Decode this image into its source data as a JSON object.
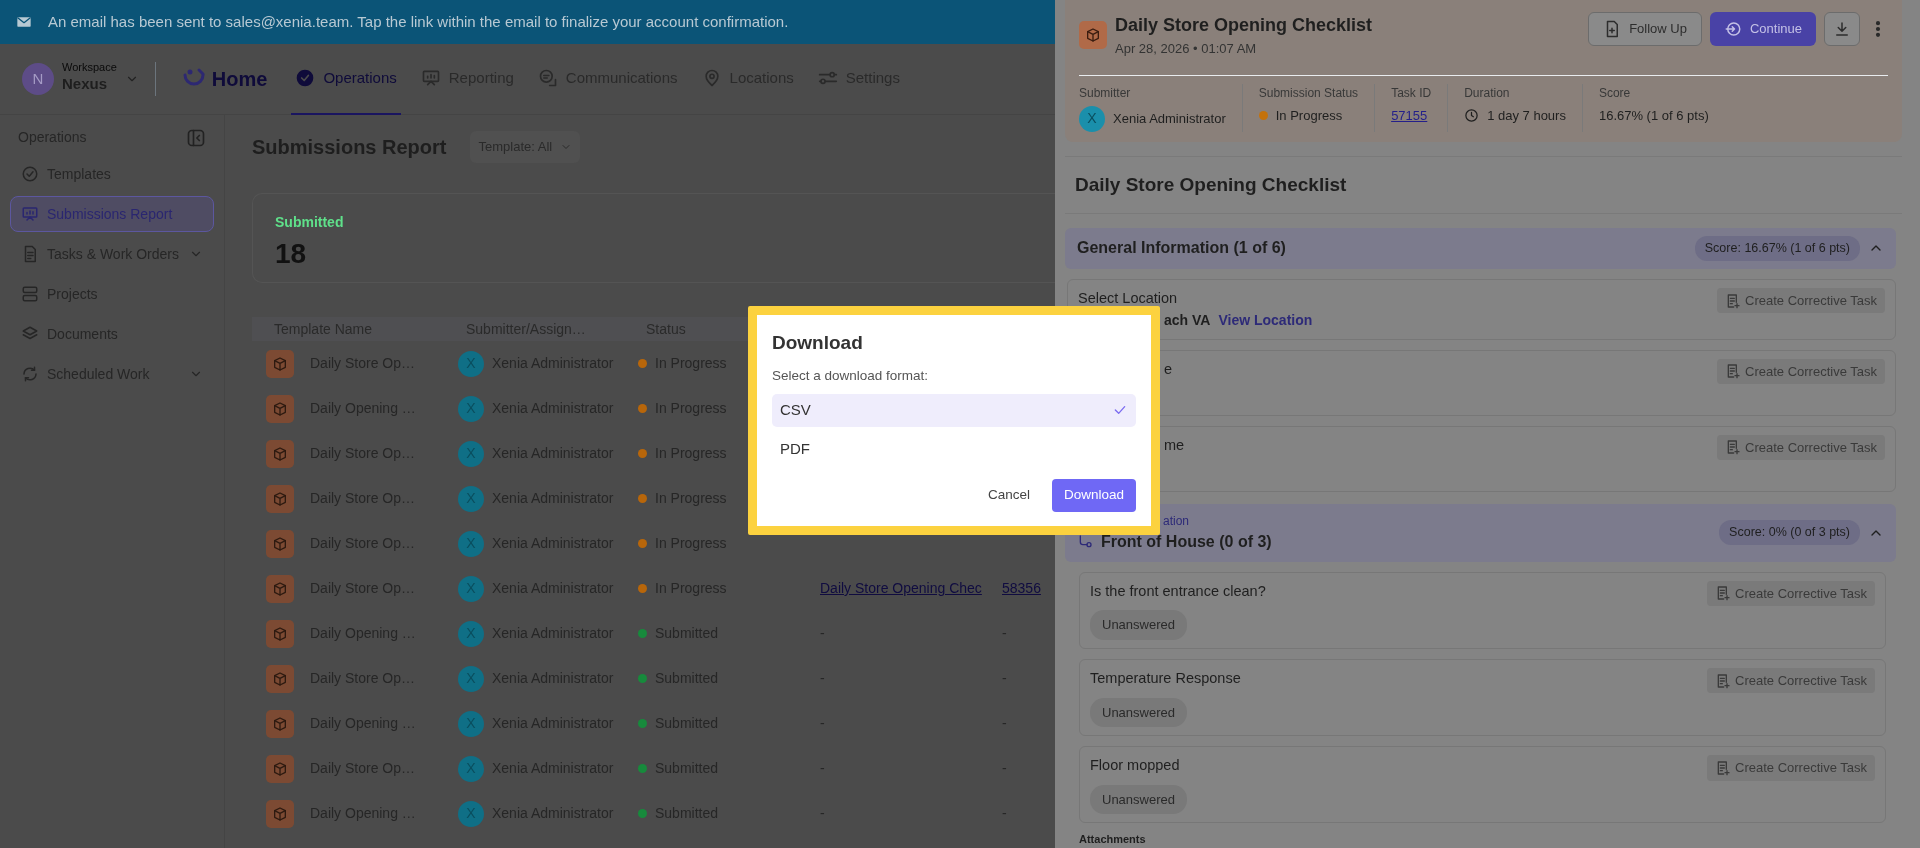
{
  "banner": {
    "text": "An email has been sent to sales@xenia.team. Tap the link within the email to finalize your account confirmation."
  },
  "workspace": {
    "avatar": "N",
    "label": "Workspace",
    "name": "Nexus"
  },
  "logo": {
    "text": "Home"
  },
  "nav": [
    {
      "label": "Operations",
      "selected": true
    },
    {
      "label": "Reporting",
      "selected": false
    },
    {
      "label": "Communications",
      "selected": false
    },
    {
      "label": "Locations",
      "selected": false
    },
    {
      "label": "Settings",
      "selected": false
    }
  ],
  "sidebar": {
    "title": "Operations",
    "items": [
      {
        "label": "Templates",
        "selected": false,
        "expandable": false
      },
      {
        "label": "Submissions Report",
        "selected": true,
        "expandable": false
      },
      {
        "label": "Tasks & Work Orders",
        "selected": false,
        "expandable": true
      },
      {
        "label": "Projects",
        "selected": false,
        "expandable": false
      },
      {
        "label": "Documents",
        "selected": false,
        "expandable": false
      },
      {
        "label": "Scheduled Work",
        "selected": false,
        "expandable": true
      }
    ]
  },
  "page": {
    "title": "Submissions Report",
    "filter": "Template: All"
  },
  "stat": {
    "label": "Submitted",
    "value": "18"
  },
  "table": {
    "columns": [
      "Template Name",
      "Submitter/Assign…",
      "Status"
    ],
    "rows": [
      {
        "template": "Daily Store Op…",
        "avatar": "X",
        "submitter": "Xenia Administrator",
        "status": "In Progress",
        "color": "#b8660a"
      },
      {
        "template": "Daily Opening …",
        "avatar": "X",
        "submitter": "Xenia Administrator",
        "status": "In Progress",
        "color": "#b8660a"
      },
      {
        "template": "Daily Store Op…",
        "avatar": "X",
        "submitter": "Xenia Administrator",
        "status": "In Progress",
        "color": "#b8660a"
      },
      {
        "template": "Daily Store Op…",
        "avatar": "X",
        "submitter": "Xenia Administrator",
        "status": "In Progress",
        "color": "#b8660a"
      },
      {
        "template": "Daily Store Op…",
        "avatar": "X",
        "submitter": "Xenia Administrator",
        "status": "In Progress",
        "color": "#b8660a"
      },
      {
        "template": "Daily Store Op…",
        "avatar": "X",
        "submitter": "Xenia Administrator",
        "status": "In Progress",
        "color": "#b8660a",
        "checklist": "Daily Store Opening Chec",
        "task_id": "58356"
      },
      {
        "template": "Daily Opening …",
        "avatar": "X",
        "submitter": "Xenia Administrator",
        "status": "Submitted",
        "color": "#178a3c",
        "checklist": "-",
        "task_id": "-"
      },
      {
        "template": "Daily Store Op…",
        "avatar": "X",
        "submitter": "Xenia Administrator",
        "status": "Submitted",
        "color": "#178a3c",
        "checklist": "-",
        "task_id": "-"
      },
      {
        "template": "Daily Opening …",
        "avatar": "X",
        "submitter": "Xenia Administrator",
        "status": "Submitted",
        "color": "#178a3c",
        "checklist": "-",
        "task_id": "-"
      },
      {
        "template": "Daily Store Op…",
        "avatar": "X",
        "submitter": "Xenia Administrator",
        "status": "Submitted",
        "color": "#178a3c",
        "checklist": "-",
        "task_id": "-"
      },
      {
        "template": "Daily Opening …",
        "avatar": "X",
        "submitter": "Xenia Administrator",
        "status": "Submitted",
        "color": "#178a3c",
        "checklist": "-",
        "task_id": "-"
      }
    ]
  },
  "drawer": {
    "title": "Daily Store Opening Checklist",
    "date": "Apr 28, 2026 • 01:07 AM",
    "actions": [
      {
        "label": "Follow Up",
        "kind": "outline"
      },
      {
        "label": "Continue",
        "kind": "primary"
      }
    ],
    "meta": [
      {
        "label": "Submitter",
        "value": "Xenia Administrator",
        "kind": "user",
        "avatar": "X"
      },
      {
        "label": "Submission Status",
        "value": "In Progress",
        "kind": "status",
        "color": "#c4720c"
      },
      {
        "label": "Task ID",
        "value": "57155",
        "kind": "link"
      },
      {
        "label": "Duration",
        "value": "1 day 7 hours",
        "kind": "duration"
      },
      {
        "label": "Score",
        "value": "16.67% (1 of 6 pts)",
        "kind": "text"
      }
    ],
    "heading": "Daily Store Opening Checklist",
    "sections": [
      {
        "title": "General Information (1 of 6)",
        "score": "Score: 16.67% (1 of 6 pts)",
        "expanded": true,
        "items": [
          {
            "question": "Select Location",
            "answer": "ach VA",
            "link": "View Location",
            "action": "Create Corrective Task",
            "kind": "partial"
          },
          {
            "question": "e",
            "action": "Create Corrective Task",
            "kind": "partial"
          },
          {
            "question": "me",
            "action": "Create Corrective Task",
            "kind": "partial"
          }
        ]
      },
      {
        "caption": "ation",
        "title": "Front of House (0 of 3)",
        "score": "Score: 0% (0 of 3 pts)",
        "expanded": true,
        "items": [
          {
            "question": "Is the front entrance clean?",
            "chip": "Unanswered",
            "action": "Create Corrective Task",
            "kind": "full"
          },
          {
            "question": "Temperature Response",
            "chip": "Unanswered",
            "action": "Create Corrective Task",
            "kind": "full"
          },
          {
            "question": "Floor mopped",
            "chip": "Unanswered",
            "action": "Create Corrective Task",
            "kind": "full"
          }
        ]
      }
    ],
    "attachments": "Attachments"
  },
  "dialog": {
    "title": "Download",
    "prompt": "Select a download format:",
    "options": [
      {
        "label": "CSV",
        "selected": true
      },
      {
        "label": "PDF",
        "selected": false
      }
    ],
    "cancel": "Cancel",
    "confirm": "Download"
  }
}
